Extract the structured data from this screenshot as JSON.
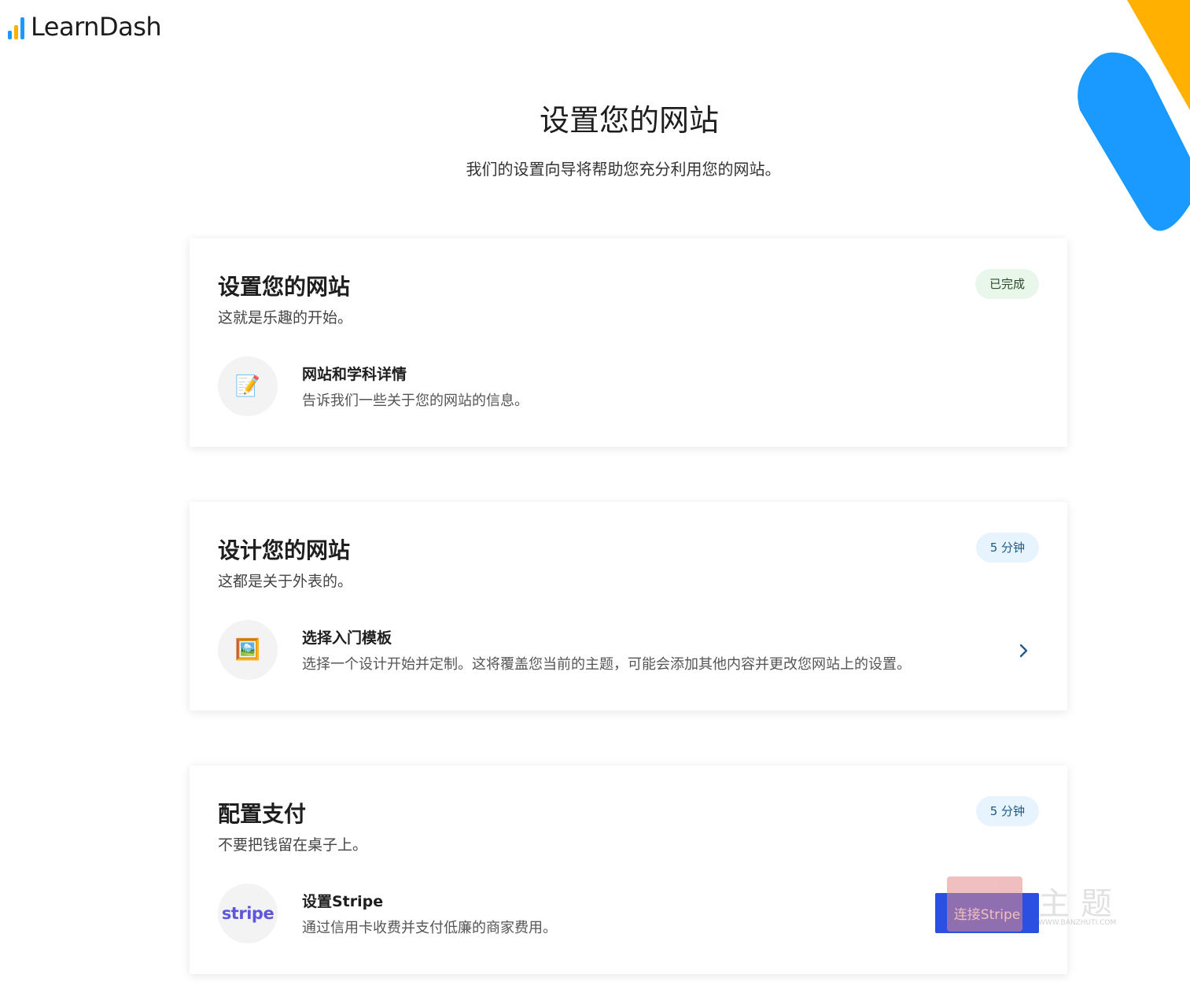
{
  "brand": {
    "name": "LearnDash",
    "accent_blue": "#1a9aff",
    "accent_yellow": "#ffb000"
  },
  "header": {
    "title": "设置您的网站",
    "subtitle": "我们的设置向导将帮助您充分利用您的网站。"
  },
  "cards": [
    {
      "title": "设置您的网站",
      "description": "这就是乐趣的开始。",
      "badge": "已完成",
      "step": {
        "icon": "memo-pencil-icon",
        "icon_glyph": "📝",
        "title": "网站和学科详情",
        "description": "告诉我们一些关于您的网站的信息。"
      }
    },
    {
      "title": "设计您的网站",
      "description": "这都是关于外表的。",
      "badge": "5 分钟",
      "step": {
        "icon": "framed-picture-icon",
        "icon_glyph": "🖼️",
        "title": "选择入门模板",
        "description": "选择一个设计开始并定制。这将覆盖您当前的主题，可能会添加其他内容并更改您网站上的设置。"
      }
    },
    {
      "title": "配置支付",
      "description": "不要把钱留在桌子上。",
      "badge": "5 分钟",
      "step": {
        "icon": "stripe-logo-icon",
        "icon_text": "stripe",
        "title": "设置Stripe",
        "description": "通过信用卡收费并支付低廉的商家费用。",
        "button_label": "连接Stripe"
      }
    }
  ],
  "watermark": {
    "chars": "主题",
    "url": "WWW.BANZHUTI.COM"
  }
}
